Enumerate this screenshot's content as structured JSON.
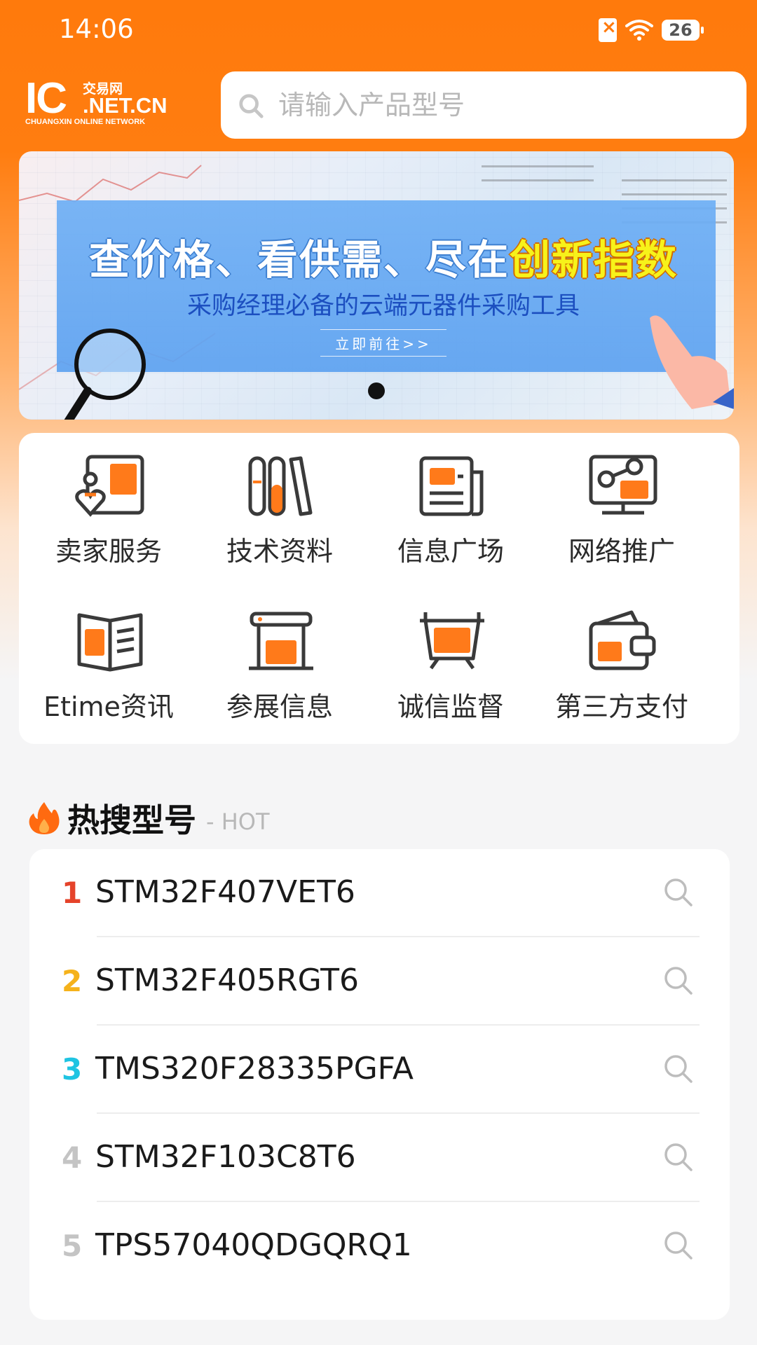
{
  "status_bar": {
    "time": "14:06",
    "battery": "26"
  },
  "header": {
    "logo": {
      "ic": "IC",
      "cn": "交易网",
      "net": ".NET.CN",
      "sub": "CHUANGXIN ONLINE NETWORK"
    },
    "search_placeholder": "请输入产品型号"
  },
  "banner": {
    "headline_main": "查价格、看供需、尽在",
    "headline_highlight": "创新指数",
    "subtitle": "采购经理必备的云端元器件采购工具",
    "cta": "立即前往>>"
  },
  "features": [
    {
      "label": "卖家服务",
      "icon": "seller-service-icon"
    },
    {
      "label": "技术资料",
      "icon": "tech-docs-icon"
    },
    {
      "label": "信息广场",
      "icon": "info-plaza-icon"
    },
    {
      "label": "网络推广",
      "icon": "network-promo-icon"
    },
    {
      "label": "Etime资讯",
      "icon": "etime-news-icon"
    },
    {
      "label": "参展信息",
      "icon": "exhibition-icon"
    },
    {
      "label": "诚信监督",
      "icon": "integrity-icon"
    },
    {
      "label": "第三方支付",
      "icon": "wallet-icon"
    }
  ],
  "hot": {
    "title": "热搜型号",
    "tag": "- HOT",
    "items": [
      {
        "rank": "1",
        "part": "STM32F407VET6",
        "color": "#e5432a"
      },
      {
        "rank": "2",
        "part": "STM32F405RGT6",
        "color": "#f5b21b"
      },
      {
        "rank": "3",
        "part": "TMS320F28335PGFA",
        "color": "#1fc4e2"
      },
      {
        "rank": "4",
        "part": "STM32F103C8T6",
        "color": "#c4c4c4"
      },
      {
        "rank": "5",
        "part": "TPS57040QDGQRQ1",
        "color": "#c4c4c4"
      }
    ]
  },
  "colors": {
    "brand": "#ff7a0c",
    "icon_orange": "#ff7a1a",
    "icon_dark": "#3a3a3a"
  }
}
